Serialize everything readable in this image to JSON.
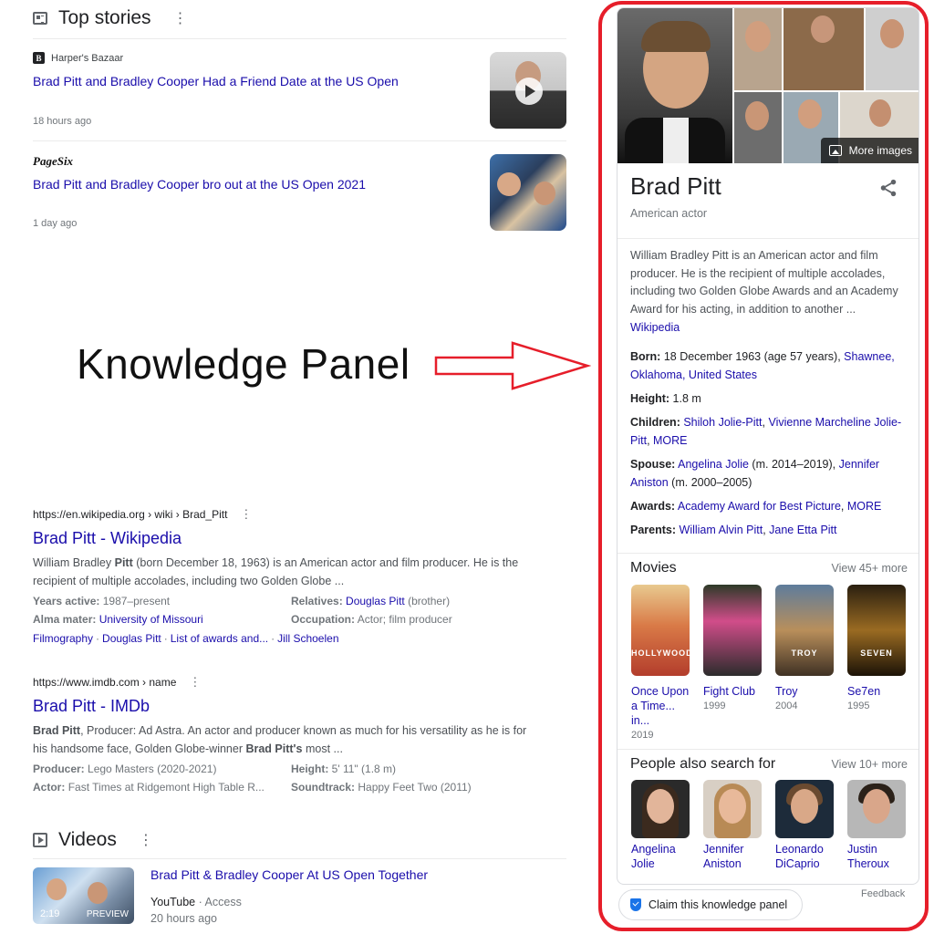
{
  "top_stories": {
    "title": "Top stories",
    "menu": "⋮",
    "items": [
      {
        "source": "Harper's Bazaar",
        "source_logo": "B",
        "headline": "Brad Pitt and Bradley Cooper Had a Friend Date at the US Open",
        "time": "18 hours ago"
      },
      {
        "source": "PageSix",
        "headline": "Brad Pitt and Bradley Cooper bro out at the US Open 2021",
        "time": "1 day ago"
      }
    ]
  },
  "annotation": {
    "label": "Knowledge Panel",
    "color": "#e61e2a"
  },
  "wikipedia": {
    "url": "https://en.wikipedia.org › wiki › Brad_Pitt",
    "menu": "⋮",
    "title": "Brad Pitt - Wikipedia",
    "snippet_a": "William Bradley ",
    "snippet_b": "Pitt",
    "snippet_c": " (born December 18, 1963) is an American actor and film producer. He is the recipient of multiple accolades, including two Golden Globe ...",
    "facts": [
      {
        "k": "Years active:",
        "v": "1987–present",
        "link": ""
      },
      {
        "k": "Relatives:",
        "v": " (brother)",
        "link": "Douglas Pitt"
      },
      {
        "k": "Alma mater:",
        "v": "",
        "link": "University of Missouri"
      },
      {
        "k": "Occupation:",
        "v": "Actor; film producer",
        "link": ""
      }
    ],
    "sitelinks": [
      "Filmography",
      "Douglas Pitt",
      "List of awards and...",
      "Jill Schoelen"
    ],
    "sep": "·"
  },
  "imdb": {
    "url": "https://www.imdb.com › name",
    "menu": "⋮",
    "title": "Brad Pitt - IMDb",
    "s1": "Brad Pitt",
    "s2": ", Producer: Ad Astra. An actor and producer known as much for his versatility as he is for his handsome face, Golden Globe-winner ",
    "s3": "Brad Pitt's",
    "s4": " most ...",
    "facts": [
      {
        "k": "Producer:",
        "v": "Lego Masters (2020-2021)"
      },
      {
        "k": "Height:",
        "v": "5' 11\" (1.8 m)"
      },
      {
        "k": "Actor:",
        "v": "Fast Times at Ridgemont High Table R..."
      },
      {
        "k": "Soundtrack:",
        "v": "Happy Feet Two (2011)"
      }
    ]
  },
  "videos": {
    "title": "Videos",
    "menu": "⋮",
    "item": {
      "title": "Brad Pitt & Bradley Cooper At US Open Together",
      "source": "YouTube",
      "channel": "· Access",
      "time": "20 hours ago",
      "duration": "2:19",
      "preview": "PREVIEW"
    }
  },
  "knowledge_panel": {
    "name": "Brad Pitt",
    "subtitle": "American actor",
    "more_images": "More images",
    "description": "William Bradley Pitt is an American actor and film producer. He is the recipient of multiple accolades, including two Golden Globe Awards and an Academy Award for his acting, in addition to another ...",
    "wiki_link": "Wikipedia",
    "born": {
      "label": "Born:",
      "text": "18 December 1963 (age 57 years), ",
      "link": "Shawnee, Oklahoma, United States"
    },
    "height": {
      "label": "Height:",
      "text": "1.8 m"
    },
    "children": {
      "label": "Children:",
      "l1": "Shiloh Jolie-Pitt",
      "l2": "Vivienne Marcheline Jolie-Pitt",
      "l3": "MORE",
      "sep": ", "
    },
    "spouse": {
      "label": "Spouse:",
      "l1": "Angelina Jolie",
      "t1": " (m. 2014–2019), ",
      "l2": "Jennifer Aniston",
      "t2": " (m. 2000–2005)"
    },
    "awards": {
      "label": "Awards:",
      "l1": "Academy Award for Best Picture",
      "sep": ", ",
      "l2": "MORE"
    },
    "parents": {
      "label": "Parents:",
      "l1": "William Alvin Pitt",
      "sep": ", ",
      "l2": "Jane Etta Pitt"
    },
    "movies": {
      "title": "Movies",
      "more": "View 45+ more",
      "items": [
        {
          "title": "Once Upon a Time... in...",
          "year": "2019",
          "poster_text": "HOLLYWOOD"
        },
        {
          "title": "Fight Club",
          "year": "1999",
          "poster_text": ""
        },
        {
          "title": "Troy",
          "year": "2004",
          "poster_text": "TROY"
        },
        {
          "title": "Se7en",
          "year": "1995",
          "poster_text": "SEVEN"
        }
      ]
    },
    "people": {
      "title": "People also search for",
      "more": "View 10+ more",
      "items": [
        {
          "name": "Angelina Jolie"
        },
        {
          "name": "Jennifer Aniston"
        },
        {
          "name": "Leonardo DiCaprio"
        },
        {
          "name": "Justin Theroux"
        }
      ]
    },
    "claim": "Claim this knowledge panel",
    "feedback": "Feedback"
  }
}
